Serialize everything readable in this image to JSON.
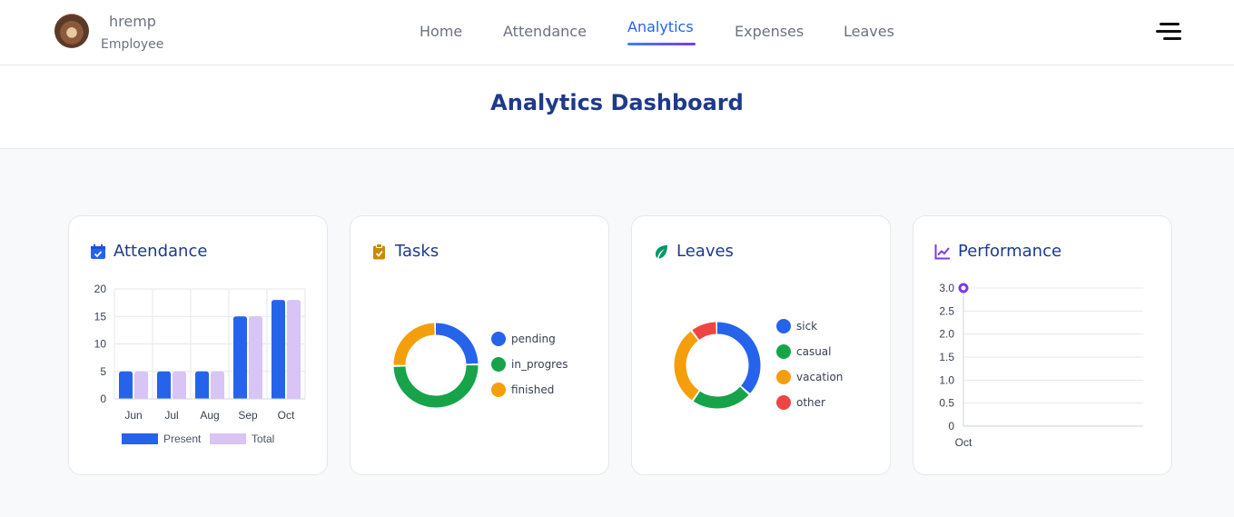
{
  "user": {
    "name": "hremp",
    "role": "Employee"
  },
  "nav": [
    {
      "label": "Home",
      "active": false
    },
    {
      "label": "Attendance",
      "active": false
    },
    {
      "label": "Analytics",
      "active": true
    },
    {
      "label": "Expenses",
      "active": false
    },
    {
      "label": "Leaves",
      "active": false
    }
  ],
  "page_title": "Analytics Dashboard",
  "cards": {
    "attendance": {
      "title": "Attendance",
      "icon": "calendar-check-icon"
    },
    "tasks": {
      "title": "Tasks",
      "icon": "clipboard-check-icon"
    },
    "leaves": {
      "title": "Leaves",
      "icon": "leaf-icon"
    },
    "performance": {
      "title": "Performance",
      "icon": "chart-line-icon"
    }
  },
  "colors": {
    "accent": "#2563eb",
    "title": "#1e3a8a",
    "present": "#2563eb",
    "total": "#d8c4f5",
    "green": "#16a34a",
    "orange": "#f59e0b",
    "red": "#ef4444",
    "purple": "#7c3aed"
  },
  "chart_data": [
    {
      "type": "bar",
      "title": "",
      "categories": [
        "Jun",
        "Jul",
        "Aug",
        "Sep",
        "Oct"
      ],
      "series": [
        {
          "name": "Present",
          "values": [
            5,
            5,
            5,
            15,
            18
          ]
        },
        {
          "name": "Total",
          "values": [
            5,
            5,
            5,
            15,
            18
          ]
        }
      ],
      "ylim": [
        0,
        20
      ],
      "yticks": [
        0,
        5,
        10,
        15,
        20
      ],
      "grid": true,
      "legend": "bottom"
    },
    {
      "type": "pie",
      "variant": "doughnut",
      "labels": [
        "pending",
        "in_progres",
        "finished"
      ],
      "values": [
        25,
        50,
        25
      ],
      "legend": "right"
    },
    {
      "type": "pie",
      "variant": "doughnut",
      "labels": [
        "sick",
        "casual",
        "vacation",
        "other"
      ],
      "values": [
        37,
        23,
        30,
        10
      ],
      "legend": "right"
    },
    {
      "type": "line",
      "x": [
        "Oct"
      ],
      "y": [
        3.0
      ],
      "ylim": [
        0,
        3.0
      ],
      "yticks": [
        "0",
        "0.5",
        "1.0",
        "1.5",
        "2.0",
        "2.5",
        "3.0"
      ],
      "grid": true
    }
  ]
}
